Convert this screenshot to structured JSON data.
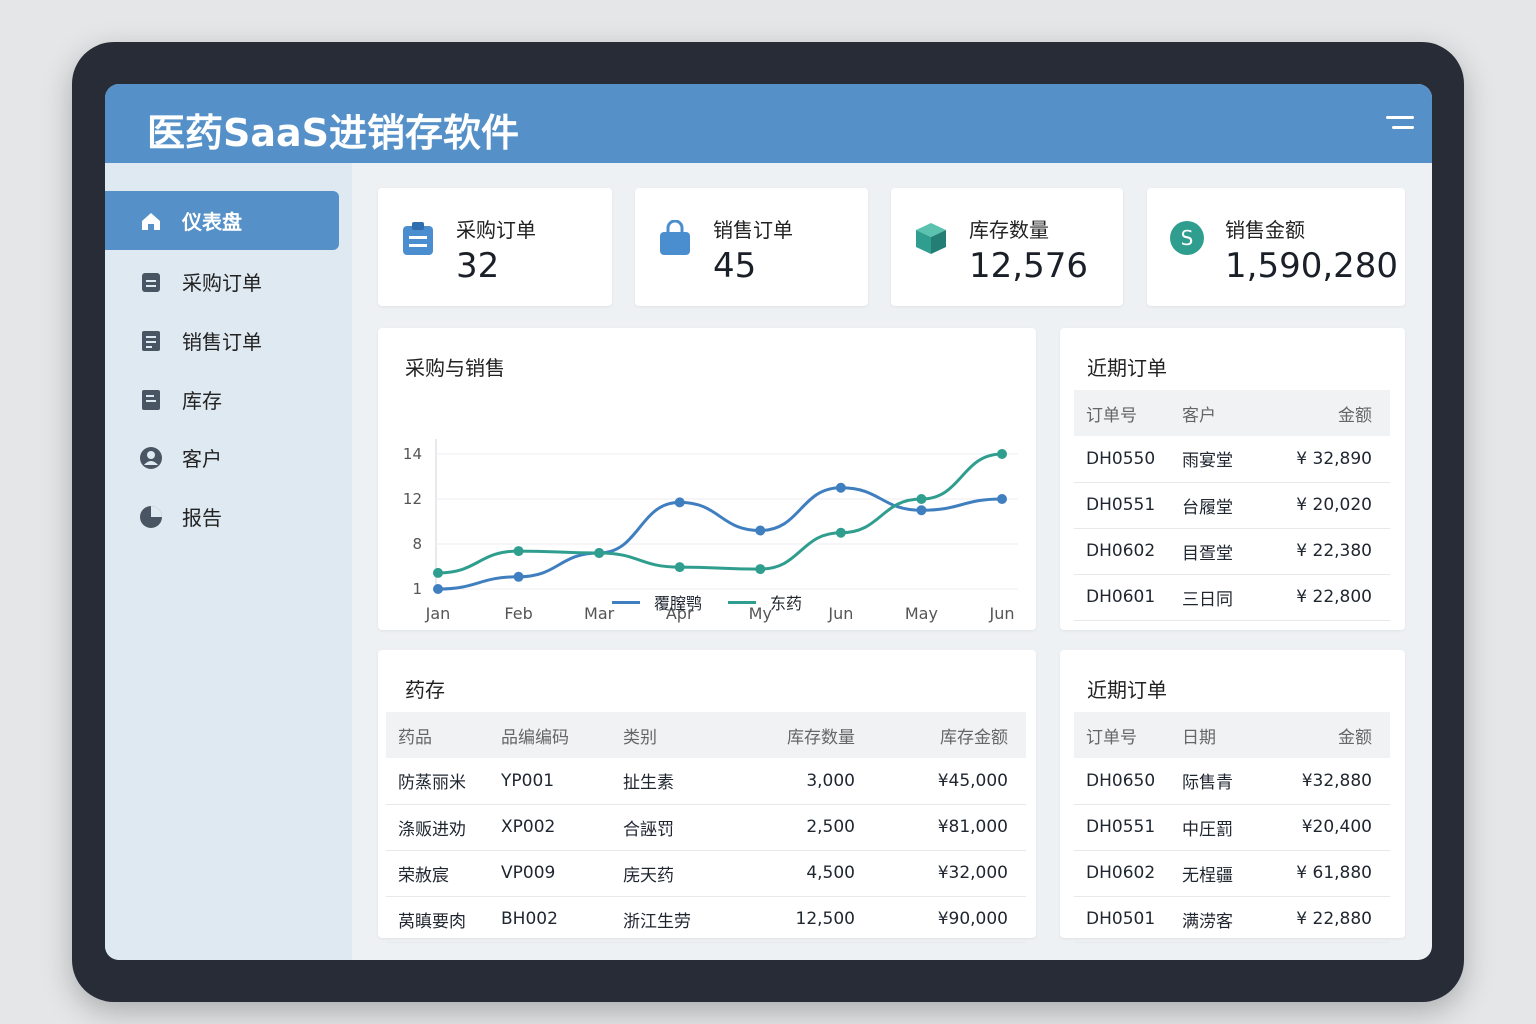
{
  "app": {
    "title": "医药SaaS进销存软件"
  },
  "sidebar": {
    "items": [
      {
        "label": "仪表盘",
        "icon": "home-icon",
        "active": true
      },
      {
        "label": "采购订单",
        "icon": "clipboard-icon"
      },
      {
        "label": "销售订单",
        "icon": "document-icon"
      },
      {
        "label": "库存",
        "icon": "box-list-icon"
      },
      {
        "label": "客户",
        "icon": "user-icon"
      },
      {
        "label": "报告",
        "icon": "pie-chart-icon"
      }
    ]
  },
  "stats": [
    {
      "label": "采购订单",
      "value": "32",
      "icon": "clipboard-icon"
    },
    {
      "label": "销售订单",
      "value": "45",
      "icon": "shopping-bag-icon"
    },
    {
      "label": "库存数量",
      "value": "12,576",
      "icon": "cube-icon"
    },
    {
      "label": "销售金额",
      "value": "1,590,280",
      "icon": "dollar-icon"
    }
  ],
  "colors": {
    "accent": "#5591c8",
    "series1": "#3f7fbf",
    "series2": "#2f9e8f"
  },
  "chart_data": {
    "type": "line",
    "title": "采购与销售",
    "categories": [
      "Jan",
      "Feb",
      "Mar",
      "Apr",
      "My",
      "Jun",
      "May",
      "Jun"
    ],
    "yticks": [
      1,
      8,
      12,
      14
    ],
    "series": [
      {
        "name": "覆膣鹗",
        "color": "#3f7fbf",
        "values": [
          1,
          2.9,
          6.6,
          11.7,
          9.2,
          12.5,
          11.0,
          12
        ]
      },
      {
        "name": "东药",
        "color": "#2f9e8f",
        "values": [
          3.5,
          6.9,
          6.6,
          4.4,
          4.1,
          9.0,
          12,
          14
        ]
      }
    ],
    "legend": "bottom"
  },
  "recent_orders": {
    "title": "近期订单",
    "headers": [
      "订单号",
      "客户",
      "金额"
    ],
    "rows": [
      [
        "DH0550",
        "雨宴堂",
        "¥ 32,890"
      ],
      [
        "DH0551",
        "台履堂",
        "¥ 20,020"
      ],
      [
        "DH0602",
        "目疍堂",
        "¥ 22,380"
      ],
      [
        "DH0601",
        "三日同",
        "¥ 22,800"
      ]
    ]
  },
  "inventory": {
    "title": "药存",
    "headers": [
      "药品",
      "品编编码",
      "类别",
      "库存数量",
      "库存金额"
    ],
    "rows": [
      [
        "防蒸丽米",
        "YP001",
        "扯生素",
        "3,000",
        "¥45,000"
      ],
      [
        "涤贩进劝",
        "XP002",
        "合誣罚",
        "2,500",
        "¥81,000"
      ],
      [
        "荣赦宸",
        "VP009",
        "庑天药",
        "4,500",
        "¥32,000"
      ],
      [
        "莴瞋要肉",
        "BH002",
        "浙江生劳",
        "12,500",
        "¥90,000"
      ]
    ]
  },
  "recent_orders2": {
    "title": "近期订单",
    "headers": [
      "订单号",
      "日期",
      "金额"
    ],
    "rows": [
      [
        "DH0650",
        "际售青",
        "¥32,880"
      ],
      [
        "DH0551",
        "中圧罰",
        "¥20,400"
      ],
      [
        "DH0602",
        "无桯疆",
        "¥ 61,880"
      ],
      [
        "DH0501",
        "满涝客",
        "¥ 22,880"
      ]
    ]
  }
}
